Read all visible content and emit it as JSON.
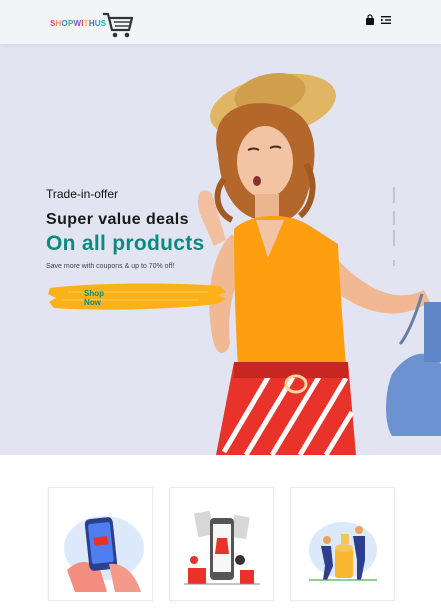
{
  "header": {
    "logo_text": [
      {
        "ch": "S",
        "color": "#e84393"
      },
      {
        "ch": "H",
        "color": "#fd9644"
      },
      {
        "ch": "O",
        "color": "#4b7bec"
      },
      {
        "ch": "P",
        "color": "#20bf6b"
      },
      {
        "ch": "W",
        "color": "#8854d0"
      },
      {
        "ch": "I",
        "color": "#eb3b5a"
      },
      {
        "ch": "T",
        "color": "#f7b731"
      },
      {
        "ch": "H",
        "color": "#3867d6"
      },
      {
        "ch": "U",
        "color": "#2d98da"
      },
      {
        "ch": "S",
        "color": "#0fb9b1"
      }
    ],
    "icons": [
      "shopping-bag-icon",
      "menu-icon"
    ]
  },
  "hero": {
    "offer_label": "Trade-in-offer",
    "headline": "Super value deals",
    "subheadline": "On all products",
    "tagline": "Save more with coupons & up to 70% off!",
    "button_label": "Shop Now"
  },
  "colors": {
    "accent": "#0c8a7f",
    "hero_bg": "#e2e4f2",
    "button_brush": "#fbb117",
    "top_dress": "#ff9f10",
    "skirt_red": "#e8322a"
  },
  "features": [
    {
      "icon": "mobile-shopping-icon"
    },
    {
      "icon": "online-store-icon"
    },
    {
      "icon": "savings-icon"
    }
  ]
}
